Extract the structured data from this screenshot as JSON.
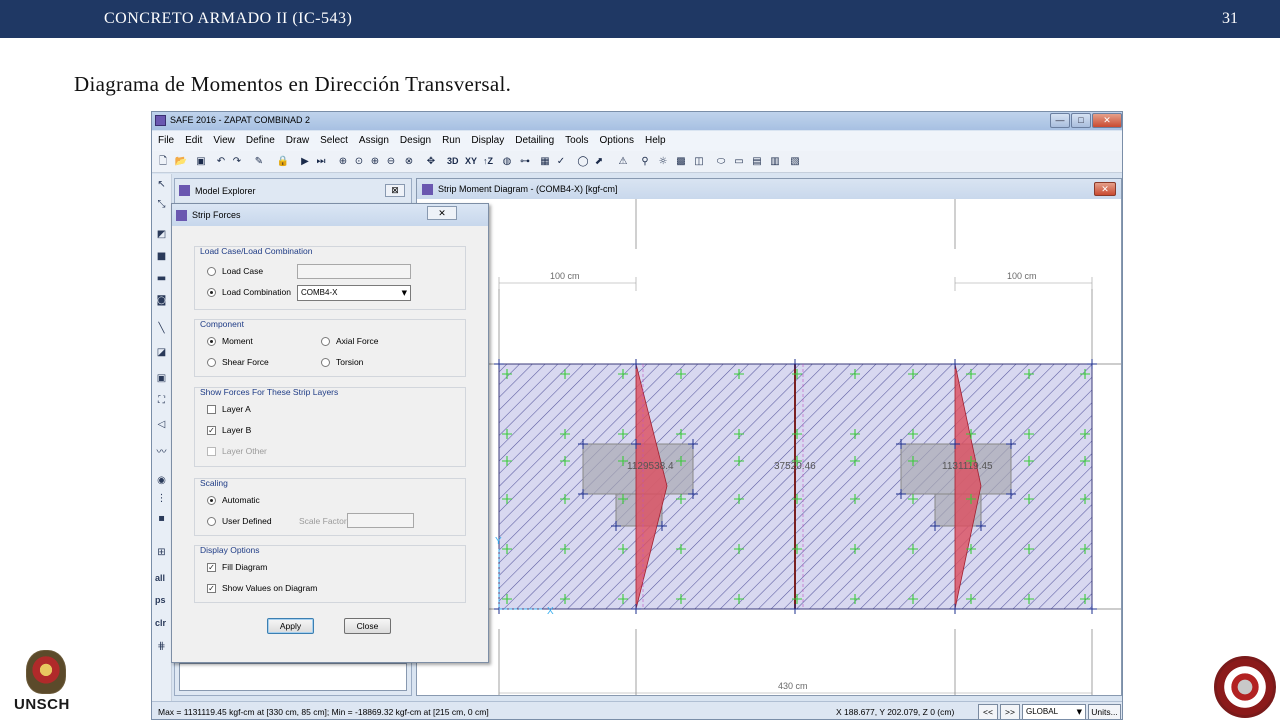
{
  "slide": {
    "header_title": "CONCRETO ARMADO II (IC-543)",
    "page_number": "31",
    "title": "Diagrama de Momentos en Dirección Transversal.",
    "logo_left_text": "UNSCH"
  },
  "app": {
    "title": "SAFE 2016 - ZAPAT COMBINAD 2",
    "window_buttons": {
      "minimize": "—",
      "maximize": "□",
      "close": "✕"
    },
    "menu": [
      "File",
      "Edit",
      "View",
      "Define",
      "Draw",
      "Select",
      "Assign",
      "Design",
      "Run",
      "Display",
      "Detailing",
      "Tools",
      "Options",
      "Help"
    ],
    "toolbar_text": {
      "three_d": "3D",
      "xy": "XY",
      "tz": "↑Z"
    },
    "left_strip_text": [
      "all",
      "ps",
      "clr"
    ]
  },
  "model_explorer": {
    "title": "Model Explorer",
    "close": "⊠"
  },
  "strip_forces": {
    "title": "Strip Forces",
    "close": "✕",
    "load_case_group": {
      "label": "Load Case/Load Combination",
      "options": [
        "Load Case",
        "Load Combination"
      ],
      "selected_index": 1,
      "combination_value": "COMB4-X"
    },
    "component_group": {
      "label": "Component",
      "options": [
        "Moment",
        "Axial Force",
        "Shear Force",
        "Torsion"
      ],
      "selected": "Moment"
    },
    "layers_group": {
      "label": "Show Forces For These Strip Layers",
      "layers": [
        {
          "label": "Layer A",
          "checked": false,
          "enabled": true
        },
        {
          "label": "Layer B",
          "checked": true,
          "enabled": true
        },
        {
          "label": "Layer Other",
          "checked": false,
          "enabled": false
        }
      ]
    },
    "scaling_group": {
      "label": "Scaling",
      "options": [
        "Automatic",
        "User Defined"
      ],
      "selected": "Automatic",
      "scale_factor_label": "Scale Factor"
    },
    "display_group": {
      "label": "Display Options",
      "options": [
        {
          "label": "Fill Diagram",
          "checked": true
        },
        {
          "label": "Show Values on Diagram",
          "checked": true
        }
      ]
    },
    "apply_label": "Apply",
    "close_label": "Close"
  },
  "diagram": {
    "title": "Strip Moment Diagram  - (COMB4-X)  [kgf-cm]",
    "close": "✕",
    "dimension_left": "100 cm",
    "dimension_right": "100 cm",
    "dimension_bottom": "430 cm",
    "moment_left": "1129538.4",
    "moment_center": "37520.46",
    "moment_right": "1131119.45",
    "axis_x": "X",
    "axis_y": "Y"
  },
  "status_bar": {
    "maxmin": "Max = 1131119.45 kgf-cm at [330 cm, 85 cm];  Min = -18869.32 kgf-cm at [215 cm, 0 cm]",
    "coords": "X 188.677,  Y 202.079,  Z 0  (cm)",
    "nav_prev": "<<",
    "nav_next": ">>",
    "coord_system": "GLOBAL",
    "units": "Units..."
  },
  "colors": {
    "header_bg": "#1f3864",
    "footing_fill": "#d8d8f0",
    "hatch": "#5a5aa0",
    "moment_fill": "#dc5060",
    "green_marker": "#3acb3a",
    "blue_marker": "#1e2f8e"
  }
}
